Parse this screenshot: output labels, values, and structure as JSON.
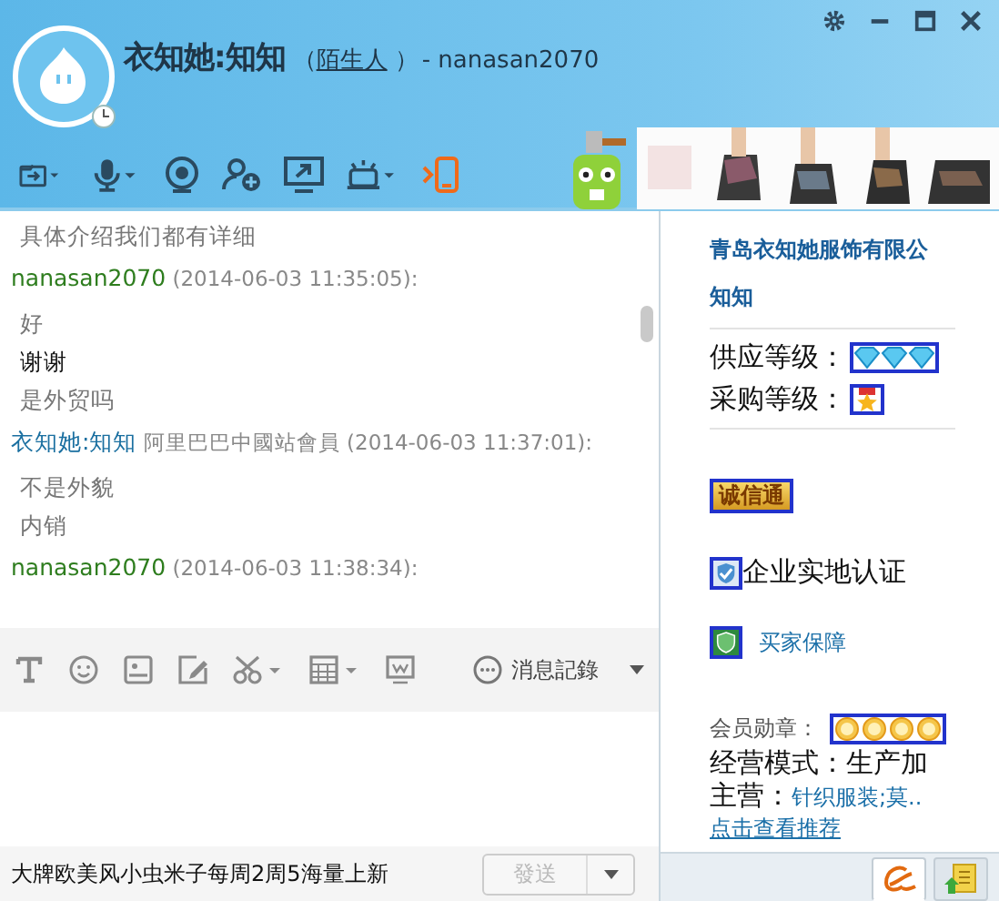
{
  "window": {
    "title": "衣知她:知知",
    "relation_open": "（",
    "relation": "陌生人",
    "relation_close": "）",
    "account": "- nanasan2070"
  },
  "chat": {
    "messages": [
      {
        "kind": "line",
        "text": "具体介绍我们都有详细"
      },
      {
        "kind": "sender",
        "name": "nanasan2070",
        "color": "#2e7d1e",
        "time": "(2014-06-03 11:35:05):"
      },
      {
        "kind": "line",
        "text": "好"
      },
      {
        "kind": "line-strong",
        "text": "谢谢"
      },
      {
        "kind": "line",
        "text": "是外贸吗"
      },
      {
        "kind": "sender",
        "name": "衣知她:知知",
        "color": "#1a6fa0",
        "member": "阿里巴巴中國站會員",
        "time": "(2014-06-03 11:37:01):"
      },
      {
        "kind": "line",
        "text": "不是外貌"
      },
      {
        "kind": "line",
        "text": "内销"
      },
      {
        "kind": "sender",
        "name": "nanasan2070",
        "color": "#2e7d1e",
        "time": "(2014-06-03 11:38:34):"
      }
    ]
  },
  "input_toolbar": {
    "history_label": "消息記錄"
  },
  "status_bar": {
    "text": "大牌欧美风小虫米子每周2周5海量上新"
  },
  "send_button": {
    "label": "發送",
    "disabled": true
  },
  "profile": {
    "company": "青岛衣知她服饰有限公",
    "name": "知知",
    "supply": {
      "label": "供应等级："
    },
    "purchase": {
      "label": "采购等级："
    },
    "badge": "诚信通",
    "certification": "企业实地认证",
    "buyer_protection": "买家保障",
    "medals": {
      "label": "会员勋章："
    },
    "business_mode": "经营模式：生产加",
    "main_label": "主营：",
    "main_value": "针织服装;莫..",
    "recommend": "点击查看推荐"
  },
  "side_tabs": [
    {
      "selected": true
    },
    {
      "selected": false
    }
  ]
}
